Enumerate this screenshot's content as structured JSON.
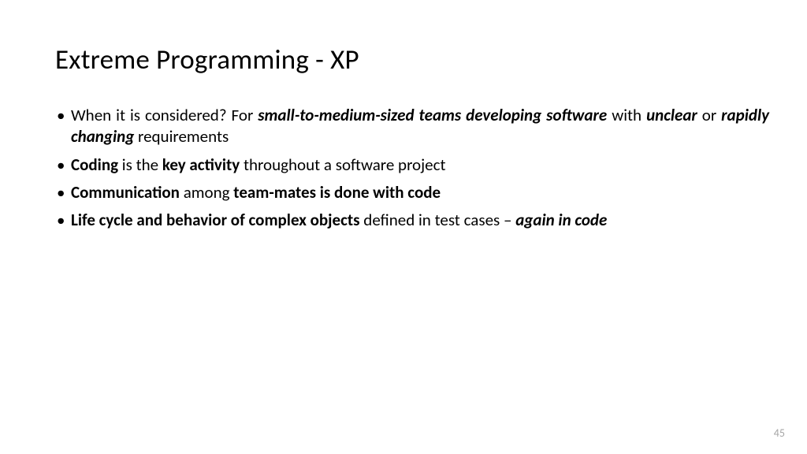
{
  "title": "Extreme Programming - XP",
  "bullets": {
    "b1_p1": "When it is considered? For ",
    "b1_p2": "small-to-medium-sized teams developing software",
    "b1_p3": " with ",
    "b1_p4": "unclear",
    "b1_p5": " or ",
    "b1_p6": "rapidly changing",
    "b1_p7": " requirements",
    "b2_p1": "Coding",
    "b2_p2": " is the ",
    "b2_p3": "key activity",
    "b2_p4": " throughout a software project",
    "b3_p1": "Communication",
    "b3_p2": " among ",
    "b3_p3": "team-mates is done with code",
    "b4_p1": "Life cycle and behavior of complex objects",
    "b4_p2": " defined in test cases – ",
    "b4_p3": "again in code"
  },
  "page_number": "45"
}
